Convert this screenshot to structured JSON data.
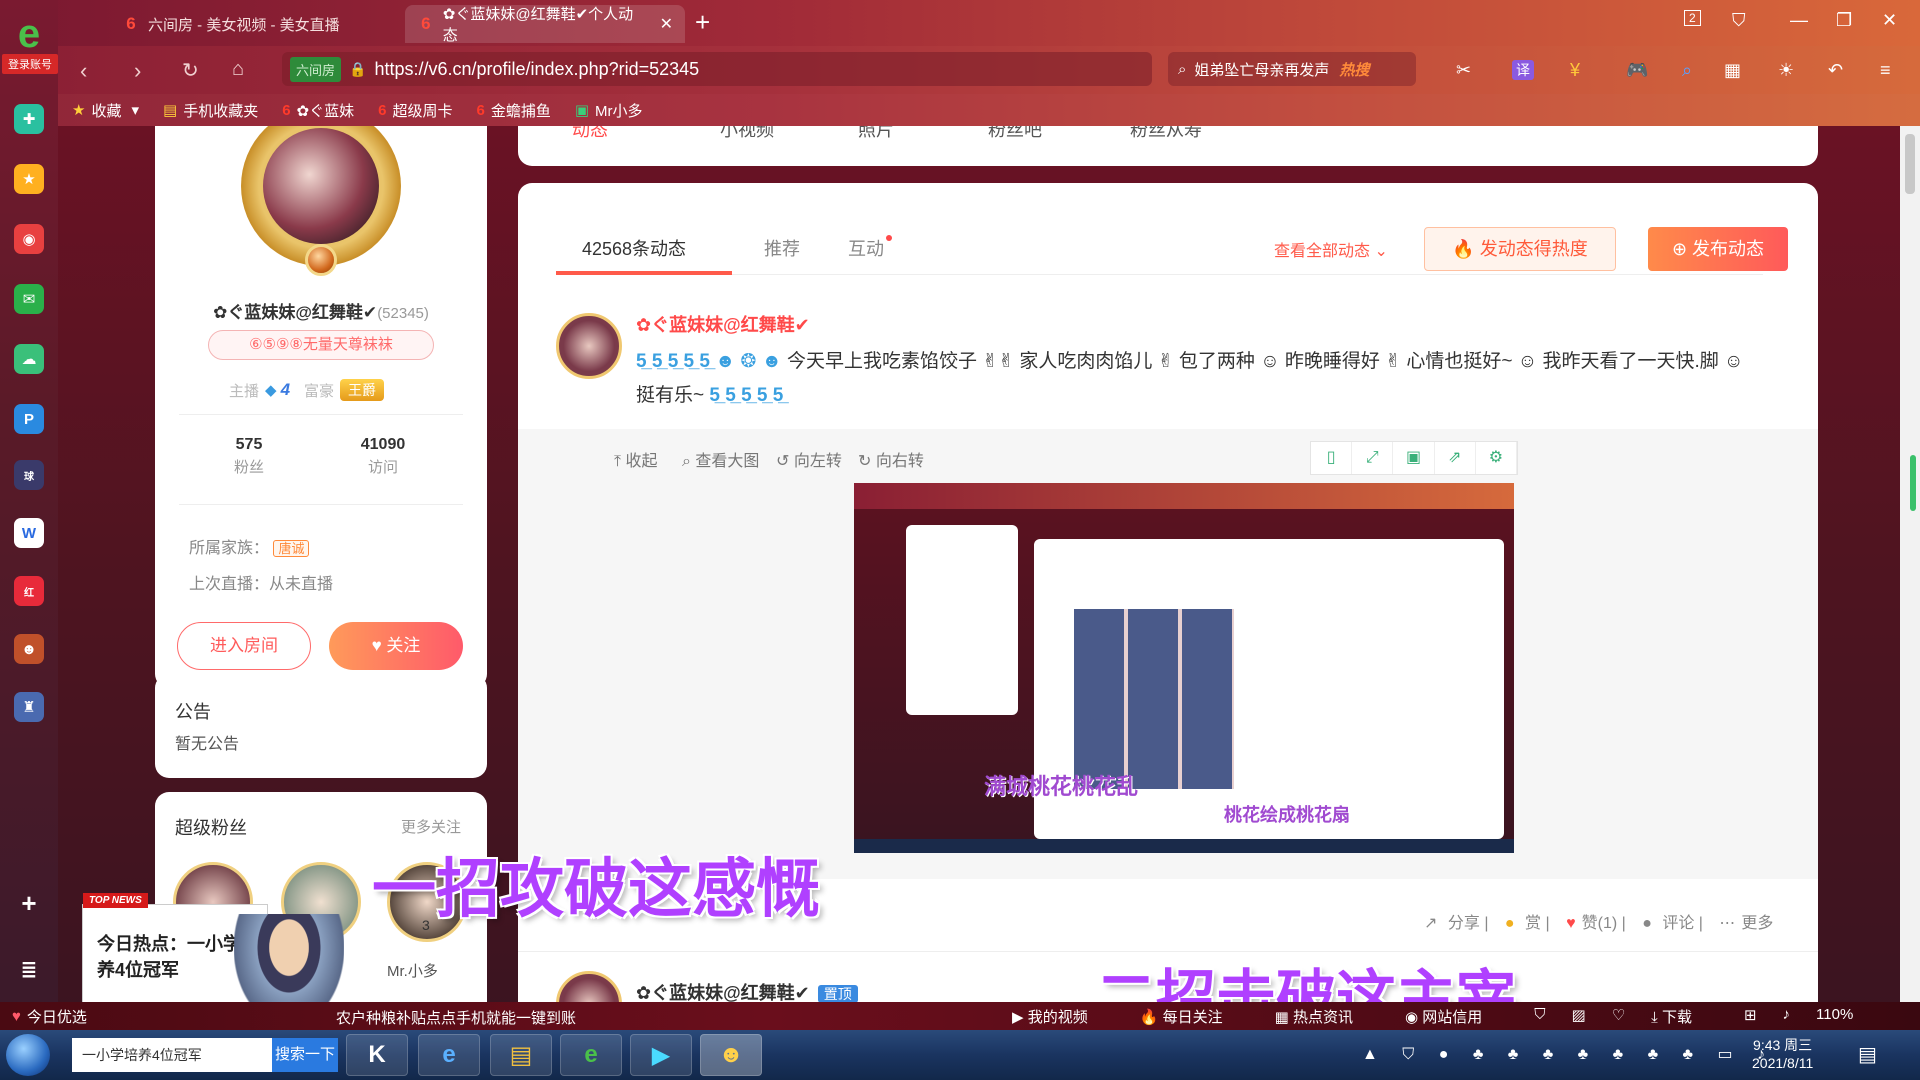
{
  "browser": {
    "tabs": [
      {
        "label": "六间房 - 美女视频 - 美女直播",
        "active": false
      },
      {
        "label": "✿ぐ蓝妹妹@红舞鞋✔个人动态",
        "active": true
      }
    ],
    "address": {
      "tag": "六间房",
      "url": "https://v6.cn/profile/index.php?rid=52345"
    },
    "search": {
      "text": "姐弟坠亡母亲再发声",
      "hot_label": "热搜"
    },
    "login_tag": "登录账号",
    "bookmarks": [
      "收藏",
      "手机收藏夹",
      "✿ぐ蓝妹",
      "超级周卡",
      "金蟾捕鱼",
      "Mr小多"
    ],
    "tab_count": "2"
  },
  "top_tabs": [
    "动态",
    "小视频",
    "照片",
    "粉丝吧",
    "粉丝从寿"
  ],
  "profile": {
    "nickname": "✿ぐ蓝妹妹@红舞鞋✔",
    "rid": "(52345)",
    "badge": "⑥⑤⑨⑧无量天尊袜袜",
    "anchor_label": "主播",
    "anchor_level": "4",
    "rich_label": "富豪",
    "rich_level": "王爵",
    "fans_count": "575",
    "fans_label": "粉丝",
    "visits_count": "41090",
    "visits_label": "访问",
    "family_label": "所属家族：",
    "family_tag": "唐诚",
    "last_live": "上次直播：从未直播",
    "enter_room": "进入房间",
    "follow": "关注"
  },
  "notice": {
    "title": "公告",
    "body": "暂无公告"
  },
  "super_fans": {
    "title": "超级粉丝",
    "more": "更多关注",
    "names": [
      "",
      "",
      "Mr.小多"
    ],
    "rank3": "3"
  },
  "feed": {
    "tabs": [
      {
        "label": "42568条动态",
        "active": true
      },
      {
        "label": "推荐",
        "active": false
      },
      {
        "label": "互动",
        "active": false
      }
    ],
    "view_all": "查看全部动态",
    "heat_button": "发动态得热度",
    "post_button": "发布动态"
  },
  "post": {
    "author": "✿ぐ蓝妹妹@红舞鞋✔",
    "text_parts": [
      "今天早上我吃素馅饺子",
      "家人吃肉肉馅儿",
      "包了两种",
      "昨晚睡得好",
      "心情也挺好~",
      "我昨天看了一天快.脚",
      "挺有乐~"
    ],
    "image_tools": [
      "收起",
      "查看大图",
      "向左转",
      "向右转"
    ],
    "actions": [
      "分享",
      "赏",
      "赞(1)",
      "评论",
      "更多"
    ]
  },
  "embedded_screenshot": {
    "caption1": "满城桃花桃花乱",
    "caption2": "桃花绘成桃花扇"
  },
  "post2": {
    "author": "✿ぐ蓝妹妹@红舞鞋✔",
    "pin": "置顶"
  },
  "overlays": {
    "caption1": "一招攻破这感慨",
    "caption2": "二招击破这主宰"
  },
  "news_popup": {
    "tag": "TOP NEWS",
    "text": "今日热点：一小学培养4位冠军"
  },
  "statusbar": {
    "left": "今日优选",
    "ticker": "农户种粮补贴点点手机就能一键到账",
    "right_items": [
      "我的视频",
      "每日关注",
      "热点资讯",
      "网站信用",
      "下载"
    ],
    "zoom": "110%"
  },
  "taskbar": {
    "search_placeholder": "一小学培养4位冠军",
    "search_button": "搜索一下",
    "time": "9:43 周三",
    "date": "2021/8/11"
  },
  "colors": {
    "accent": "#ff5a4a",
    "brand_red": "#d62828",
    "browser_gradient_start": "#7a1830",
    "browser_gradient_end": "#d9683a"
  }
}
